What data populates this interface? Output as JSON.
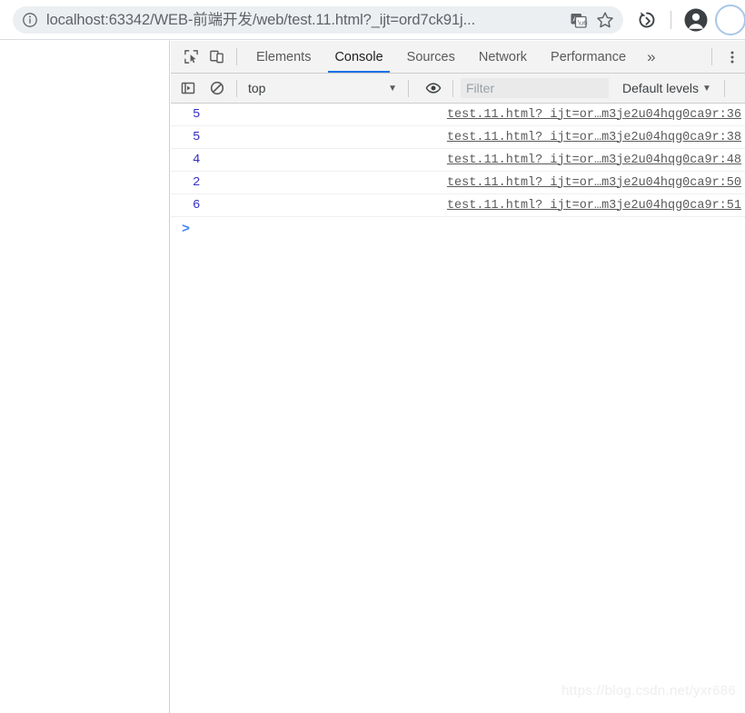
{
  "browser": {
    "omnibox": {
      "info_icon": "info-circle-icon",
      "url_host": "localhost:63342",
      "url_path": "/WEB-前端开发/web/test.11.html?_ijt=ord7ck91j...",
      "url_full": "localhost:63342/WEB-前端开发/web/test.11.html?_ijt=ord7ck91j...",
      "translate_icon": "translate-icon",
      "bookmark_icon": "star-icon"
    },
    "actions": [
      {
        "name": "sync-update-icon",
        "label": ""
      },
      {
        "name": "profile-avatar-icon",
        "label": ""
      }
    ]
  },
  "devtools": {
    "left_buttons": [
      {
        "name": "inspect-element-icon"
      },
      {
        "name": "device-toolbar-icon"
      }
    ],
    "tabs": [
      {
        "label": "Elements",
        "active": false
      },
      {
        "label": "Console",
        "active": true
      },
      {
        "label": "Sources",
        "active": false
      },
      {
        "label": "Network",
        "active": false
      },
      {
        "label": "Performance",
        "active": false
      }
    ],
    "overflow_label": "»",
    "kebab_icon": "more-options-icon",
    "toolbar": {
      "sidebar_toggle_icon": "console-sidebar-icon",
      "clear_console_icon": "clear-console-icon",
      "context": "top",
      "context_caret": "▼",
      "eye_icon": "live-expression-eye-icon",
      "filter_placeholder": "Filter",
      "filter_value": "",
      "levels_label": "Default levels",
      "levels_caret": "▼"
    },
    "console": {
      "rows": [
        {
          "value": "5",
          "source": "test.11.html?_ijt=or…m3je2u04hqg0ca9r:36"
        },
        {
          "value": "5",
          "source": "test.11.html?_ijt=or…m3je2u04hqg0ca9r:38"
        },
        {
          "value": "4",
          "source": "test.11.html?_ijt=or…m3je2u04hqg0ca9r:48"
        },
        {
          "value": "2",
          "source": "test.11.html?_ijt=or…m3je2u04hqg0ca9r:50"
        },
        {
          "value": "6",
          "source": "test.11.html?_ijt=or…m3je2u04hqg0ca9r:51"
        }
      ],
      "prompt": ">"
    }
  },
  "watermark": "https://blog.csdn.net/yxr686",
  "colors": {
    "accent_blue": "#1a73e8",
    "value_blue": "#3730c4",
    "prompt_blue": "#4285f4",
    "toolbar_bg": "#f3f3f3",
    "omnibox_bg": "#eceff1"
  }
}
